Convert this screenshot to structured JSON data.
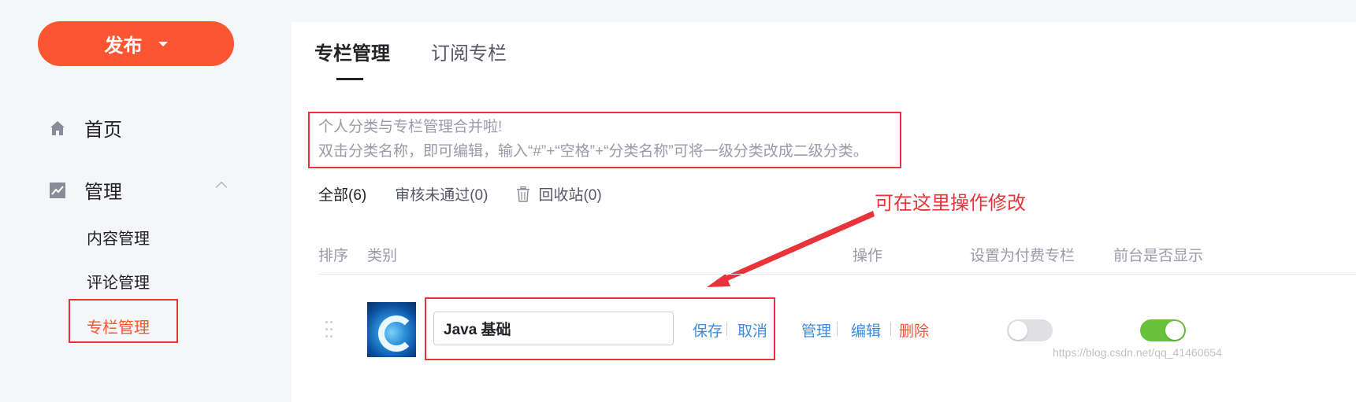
{
  "sidebar": {
    "publish_label": "发布",
    "home_label": "首页",
    "manage_label": "管理",
    "sub_items": [
      "内容管理",
      "评论管理",
      "专栏管理"
    ]
  },
  "tabs": [
    "专栏管理",
    "订阅专栏"
  ],
  "notice": {
    "line1": "个人分类与专栏管理合并啦!",
    "line2": "双击分类名称，即可编辑，输入“#”+“空格”+“分类名称”可将一级分类改成二级分类。"
  },
  "filters": {
    "all": "全部(6)",
    "rejected": "审核未通过(0)",
    "recycle": "回收站(0)"
  },
  "annotation": "可在这里操作修改",
  "table": {
    "headers": {
      "sort": "排序",
      "category": "类别",
      "actions": "操作",
      "paid": "设置为付费专栏",
      "visible": "前台是否显示"
    }
  },
  "row": {
    "name_value": "Java 基础",
    "save": "保存",
    "cancel": "取消",
    "manage": "管理",
    "edit": "编辑",
    "delete": "删除",
    "paid_on": false,
    "visible_on": true
  },
  "watermark": "https://blog.csdn.net/qq_41460654",
  "colors": {
    "accent": "#fc5531",
    "link": "#3d8be0",
    "toggle_on": "#67c23a",
    "annotation": "#e8333b"
  },
  "icons": {
    "home": "home-icon",
    "manage": "chart-icon",
    "recycle": "trash-icon",
    "drag": "drag-handle-icon"
  }
}
